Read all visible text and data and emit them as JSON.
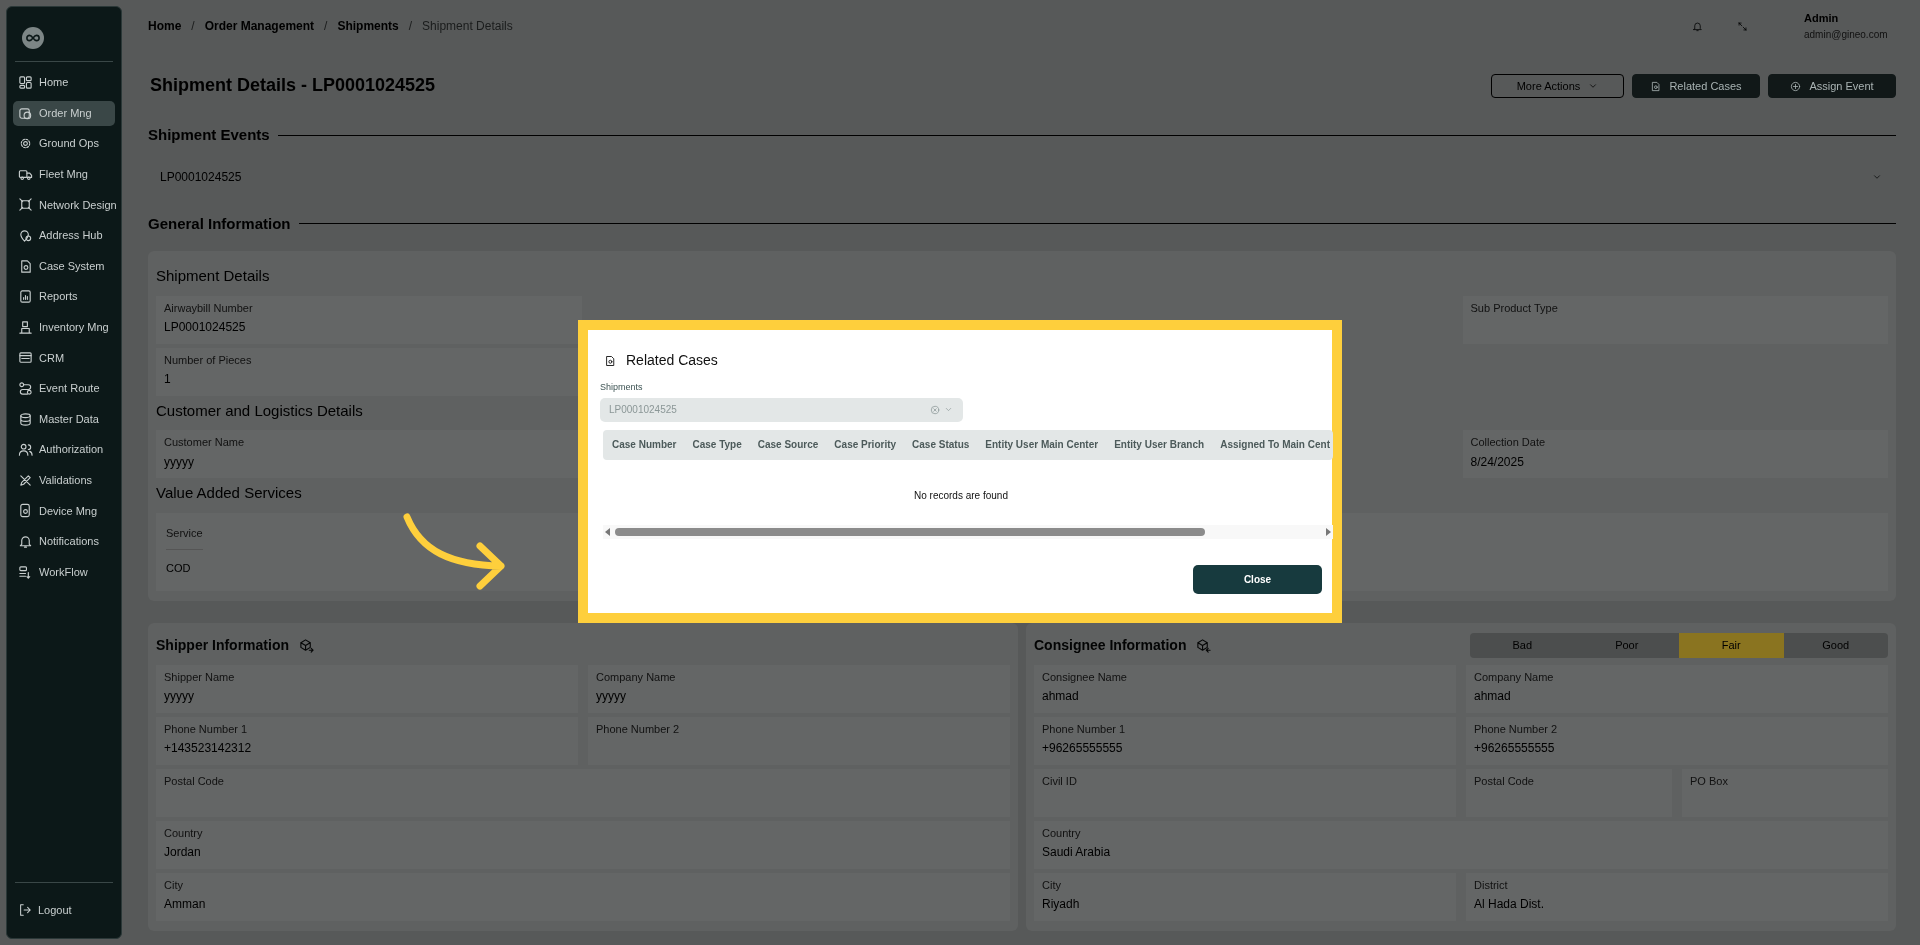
{
  "sidebar": {
    "items": [
      {
        "label": "Home",
        "selected": false
      },
      {
        "label": "Order Mng",
        "selected": true
      },
      {
        "label": "Ground Ops",
        "selected": false
      },
      {
        "label": "Fleet Mng",
        "selected": false
      },
      {
        "label": "Network Design",
        "selected": false
      },
      {
        "label": "Address Hub",
        "selected": false
      },
      {
        "label": "Case System",
        "selected": false
      },
      {
        "label": "Reports",
        "selected": false
      },
      {
        "label": "Inventory Mng",
        "selected": false
      },
      {
        "label": "CRM",
        "selected": false
      },
      {
        "label": "Event Route",
        "selected": false
      },
      {
        "label": "Master Data",
        "selected": false
      },
      {
        "label": "Authorization",
        "selected": false
      },
      {
        "label": "Validations",
        "selected": false
      },
      {
        "label": "Device Mng",
        "selected": false
      },
      {
        "label": "Notifications",
        "selected": false
      },
      {
        "label": "WorkFlow",
        "selected": false
      }
    ],
    "logout": "Logout"
  },
  "breadcrumb": [
    {
      "label": "Home",
      "current": false
    },
    {
      "separator_before": "/",
      "label": "Order Management",
      "current": false
    },
    {
      "separator_before": "/",
      "label": "Shipments",
      "current": false
    },
    {
      "separator_before": "/",
      "label": "Shipment Details",
      "current": true
    }
  ],
  "user": {
    "name": "Admin",
    "email": "admin@gineo.com"
  },
  "page_title": "Shipment Details - LP0001024525",
  "actions": [
    {
      "label": "More Actions",
      "kind": "dropdown"
    },
    {
      "label": "Related Cases",
      "kind": "cases"
    },
    {
      "label": "Assign Event",
      "kind": "event"
    }
  ],
  "shipment_events": {
    "title": "Shipment Events",
    "value": "LP0001024525"
  },
  "general_information": {
    "title": "General Information",
    "shipment_details": {
      "title": "Shipment Details",
      "rows": [
        {
          "left": {
            "label": "Airwaybill Number",
            "value": "LP0001024525"
          },
          "right": {
            "label": "Sub Product Type"
          }
        },
        {
          "left": {
            "label": "Number of Pieces",
            "value": "1"
          }
        }
      ]
    },
    "customer_logistics": {
      "title": "Customer and Logistics Details",
      "rows": [
        {
          "left": {
            "label": "Customer Name",
            "value": "yyyyy"
          },
          "right": {
            "label": "Collection Date",
            "value": "8/24/2025"
          }
        }
      ]
    },
    "value_added_services": {
      "title": "Value Added Services",
      "columns": [
        "Service"
      ],
      "rows": [
        [
          "COD"
        ]
      ]
    }
  },
  "shipper": {
    "title": "Shipper Information",
    "rows": [
      [
        {
          "label": "Shipper Name",
          "value": "yyyyy"
        },
        {
          "label": "Company Name",
          "value": "yyyyy"
        }
      ],
      [
        {
          "label": "Phone Number 1",
          "value": "+143523142312"
        },
        {
          "label": "Phone Number 2"
        }
      ],
      [
        {
          "label": "Postal Code"
        }
      ],
      [
        {
          "label": "Country",
          "value": "Jordan"
        }
      ],
      [
        {
          "label": "City",
          "value": "Amman"
        }
      ]
    ]
  },
  "consignee": {
    "title": "Consignee Information",
    "rating": [
      {
        "label": "Bad",
        "selected": false
      },
      {
        "label": "Poor",
        "selected": false
      },
      {
        "label": "Fair",
        "selected": true
      },
      {
        "label": "Good",
        "selected": false
      }
    ],
    "rows": [
      [
        {
          "label": "Consignee Name",
          "value": "ahmad"
        },
        {
          "label": "Company Name",
          "value": "ahmad"
        }
      ],
      [
        {
          "label": "Phone Number 1",
          "value": "+96265555555"
        },
        {
          "label": "Phone Number 2",
          "value": "+96265555555"
        }
      ],
      [
        {
          "label": "Civil ID"
        },
        {
          "label": "Postal Code"
        },
        {
          "label": "PO Box"
        }
      ],
      [
        {
          "label": "Country",
          "value": "Saudi Arabia"
        }
      ],
      [
        {
          "label": "City",
          "value": "Riyadh"
        },
        {
          "label": "District",
          "value": "Al Hada Dist."
        }
      ]
    ]
  },
  "modal": {
    "title": "Related Cases",
    "field_label": "Shipments",
    "field_value": "LP0001024525",
    "columns": [
      "Case Number",
      "Case Type",
      "Case Source",
      "Case Priority",
      "Case Status",
      "Entity User Main Center",
      "Entity User Branch",
      "Assigned To Main Cent"
    ],
    "empty_message": "No records are found",
    "close": "Close"
  }
}
